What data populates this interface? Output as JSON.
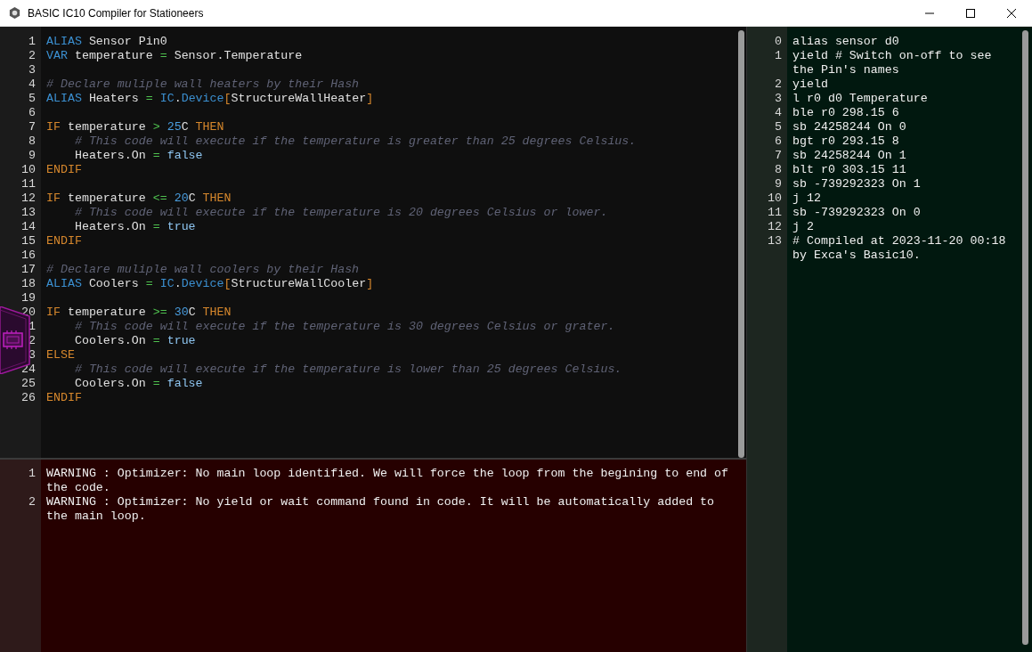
{
  "window": {
    "title": "BASIC IC10 Compiler for Stationeers"
  },
  "editor": {
    "lines": [
      {
        "number": "1",
        "tokens": [
          {
            "text": "ALIAS",
            "kind": "decl"
          },
          {
            "text": " Sensor Pin0",
            "kind": "plain"
          }
        ]
      },
      {
        "number": "2",
        "tokens": [
          {
            "text": "VAR",
            "kind": "decl"
          },
          {
            "text": " temperature ",
            "kind": "plain"
          },
          {
            "text": "=",
            "kind": "op"
          },
          {
            "text": " Sensor.Temperature",
            "kind": "plain"
          }
        ]
      },
      {
        "number": "3"
      },
      {
        "number": "4",
        "tokens": [
          {
            "text": "# Declare muliple wall heaters by their Hash",
            "kind": "comment"
          }
        ]
      },
      {
        "number": "5",
        "tokens": [
          {
            "text": "ALIAS",
            "kind": "decl"
          },
          {
            "text": " Heaters ",
            "kind": "plain"
          },
          {
            "text": "=",
            "kind": "op"
          },
          {
            "text": " IC",
            "kind": "decl"
          },
          {
            "text": ".",
            "kind": "plain"
          },
          {
            "text": "Device",
            "kind": "decl"
          },
          {
            "text": "[",
            "kind": "bracket"
          },
          {
            "text": "StructureWallHeater",
            "kind": "plain"
          },
          {
            "text": "]",
            "kind": "bracket"
          }
        ]
      },
      {
        "number": "6"
      },
      {
        "number": "7",
        "tokens": [
          {
            "text": "IF",
            "kind": "control"
          },
          {
            "text": " temperature ",
            "kind": "plain"
          },
          {
            "text": ">",
            "kind": "op"
          },
          {
            "text": " 25",
            "kind": "number"
          },
          {
            "text": "C",
            "kind": "plain"
          },
          {
            "text": " THEN",
            "kind": "control"
          }
        ]
      },
      {
        "number": "8",
        "tokens": [
          {
            "text": "    # This code will execute if the temperature is greater than 25 degrees Celsius.",
            "kind": "comment"
          }
        ]
      },
      {
        "number": "9",
        "tokens": [
          {
            "text": "    Heaters.On ",
            "kind": "plain"
          },
          {
            "text": "=",
            "kind": "op"
          },
          {
            "text": " false",
            "kind": "bool"
          }
        ]
      },
      {
        "number": "10",
        "tokens": [
          {
            "text": "ENDIF",
            "kind": "control"
          }
        ]
      },
      {
        "number": "11"
      },
      {
        "number": "12",
        "tokens": [
          {
            "text": "IF",
            "kind": "control"
          },
          {
            "text": " temperature ",
            "kind": "plain"
          },
          {
            "text": "<=",
            "kind": "op"
          },
          {
            "text": " 20",
            "kind": "number"
          },
          {
            "text": "C",
            "kind": "plain"
          },
          {
            "text": " THEN",
            "kind": "control"
          }
        ]
      },
      {
        "number": "13",
        "tokens": [
          {
            "text": "    # This code will execute if the temperature is 20 degrees Celsius or lower.",
            "kind": "comment"
          }
        ]
      },
      {
        "number": "14",
        "tokens": [
          {
            "text": "    Heaters.On ",
            "kind": "plain"
          },
          {
            "text": "=",
            "kind": "op"
          },
          {
            "text": " true",
            "kind": "bool"
          }
        ]
      },
      {
        "number": "15",
        "tokens": [
          {
            "text": "ENDIF",
            "kind": "control"
          }
        ]
      },
      {
        "number": "16"
      },
      {
        "number": "17",
        "tokens": [
          {
            "text": "# Declare muliple wall coolers by their Hash",
            "kind": "comment"
          }
        ]
      },
      {
        "number": "18",
        "tokens": [
          {
            "text": "ALIAS",
            "kind": "decl"
          },
          {
            "text": " Coolers ",
            "kind": "plain"
          },
          {
            "text": "=",
            "kind": "op"
          },
          {
            "text": " IC",
            "kind": "decl"
          },
          {
            "text": ".",
            "kind": "plain"
          },
          {
            "text": "Device",
            "kind": "decl"
          },
          {
            "text": "[",
            "kind": "bracket"
          },
          {
            "text": "StructureWallCooler",
            "kind": "plain"
          },
          {
            "text": "]",
            "kind": "bracket"
          }
        ]
      },
      {
        "number": "19"
      },
      {
        "number": "20",
        "tokens": [
          {
            "text": "IF",
            "kind": "control"
          },
          {
            "text": " temperature ",
            "kind": "plain"
          },
          {
            "text": ">=",
            "kind": "op"
          },
          {
            "text": " 30",
            "kind": "number"
          },
          {
            "text": "C",
            "kind": "plain"
          },
          {
            "text": " THEN",
            "kind": "control"
          }
        ]
      },
      {
        "number": "1",
        "tokens": [
          {
            "text": "    # This code will execute if the temperature is 30 degrees Celsius or grater.",
            "kind": "comment"
          }
        ]
      },
      {
        "number": "2",
        "tokens": [
          {
            "text": "    Coolers.On ",
            "kind": "plain"
          },
          {
            "text": "=",
            "kind": "op"
          },
          {
            "text": " true",
            "kind": "bool"
          }
        ]
      },
      {
        "number": "3",
        "tokens": [
          {
            "text": "ELSE",
            "kind": "control"
          }
        ]
      },
      {
        "number": "24",
        "tokens": [
          {
            "text": "    # This code will execute if the temperature is lower than 25 degrees Celsius.",
            "kind": "comment"
          }
        ]
      },
      {
        "number": "25",
        "tokens": [
          {
            "text": "    Coolers.On ",
            "kind": "plain"
          },
          {
            "text": "=",
            "kind": "op"
          },
          {
            "text": " false",
            "kind": "bool"
          }
        ]
      },
      {
        "number": "26",
        "tokens": [
          {
            "text": "ENDIF",
            "kind": "control"
          }
        ]
      }
    ]
  },
  "messages": {
    "lines": [
      {
        "number": "1",
        "text": "WARNING : Optimizer: No main loop identified. We will force the loop from the begining to end of the code."
      },
      {
        "number": "2",
        "text": "WARNING : Optimizer: No yield or wait command found in code. It will be automatically added to the main loop."
      }
    ]
  },
  "output": {
    "lines": [
      {
        "number": "0",
        "text": "alias sensor d0"
      },
      {
        "number": "1",
        "text": "yield # Switch on-off to see the Pin's names"
      },
      {
        "number": "2",
        "text": "yield"
      },
      {
        "number": "3",
        "text": "l r0 d0 Temperature"
      },
      {
        "number": "4",
        "text": "ble r0 298.15 6"
      },
      {
        "number": "5",
        "text": "sb 24258244 On 0"
      },
      {
        "number": "6",
        "text": "bgt r0 293.15 8"
      },
      {
        "number": "7",
        "text": "sb 24258244 On 1"
      },
      {
        "number": "8",
        "text": "blt r0 303.15 11"
      },
      {
        "number": "9",
        "text": "sb -739292323 On 1"
      },
      {
        "number": "10",
        "text": "j 12"
      },
      {
        "number": "11",
        "text": "sb -739292323 On 0"
      },
      {
        "number": "12",
        "text": "j 2"
      },
      {
        "number": "13",
        "text": "# Compiled at 2023-11-20 00:18 by Exca's Basic10."
      }
    ]
  }
}
